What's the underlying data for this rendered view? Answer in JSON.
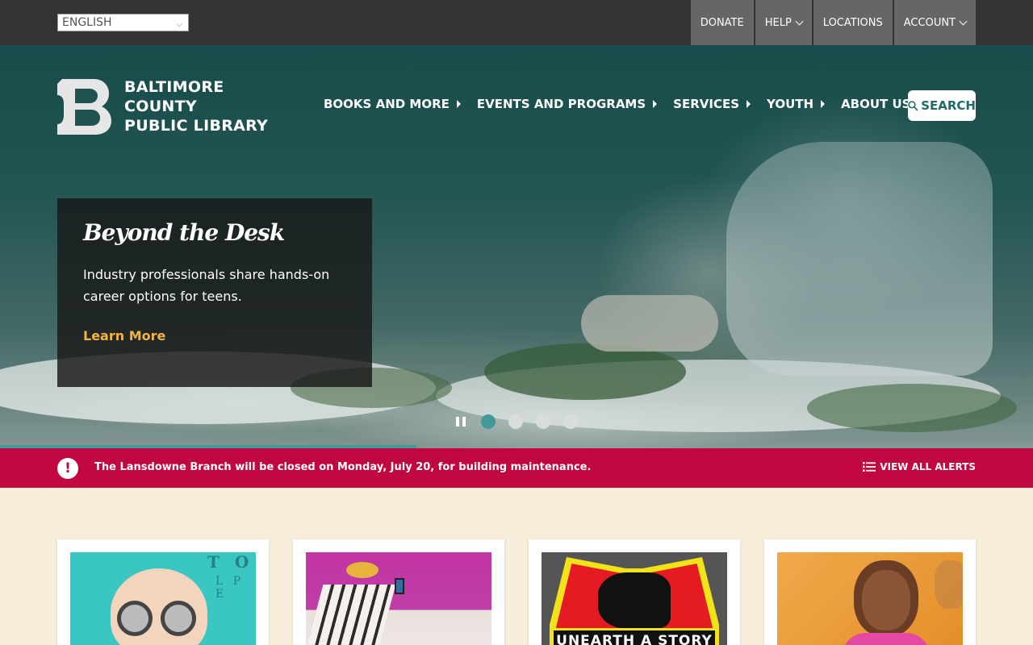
{
  "utility_bar": {
    "language": "ENGLISH",
    "links": [
      "DONATE",
      "HELP",
      "LOCATIONS",
      "ACCOUNT"
    ]
  },
  "header": {
    "logo_line1": "BALTIMORE COUNTY",
    "logo_line2": "PUBLIC LIBRARY",
    "nav": [
      "BOOKS AND MORE",
      "EVENTS AND PROGRAMS",
      "SERVICES",
      "YOUTH",
      "ABOUT US"
    ],
    "search_label": "SEARCH"
  },
  "hero": {
    "title": "Beyond the Desk",
    "description": "Industry professionals share hands-on career options for teens.",
    "link": "Learn More",
    "slides_count": 4,
    "active_slide": 1
  },
  "alert": {
    "text": "The Lansdowne Branch will be closed on Monday, July 20, for building maintenance.",
    "link": "VIEW ALL ALERTS"
  },
  "cards": {
    "card3_caption": "UNEARTH A STORY"
  },
  "colors": {
    "teal": "#1f6b68",
    "alert_red": "#c0073f",
    "gold": "#f3b53f",
    "cream": "#f7eddb"
  }
}
